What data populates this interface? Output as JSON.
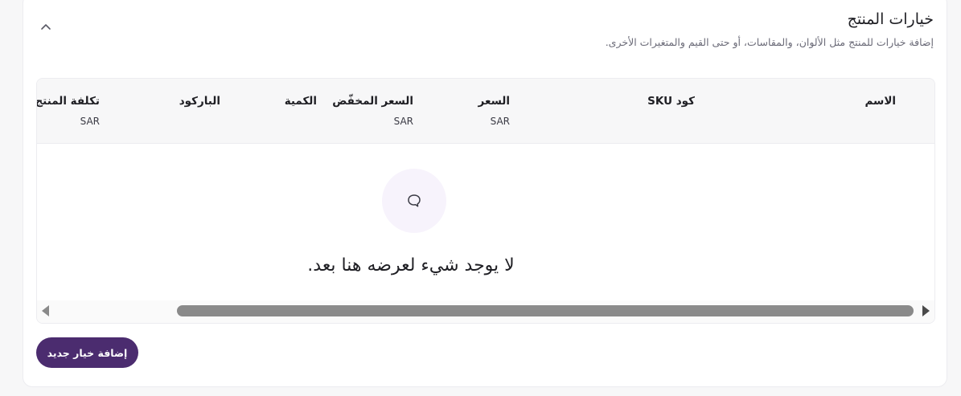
{
  "header": {
    "title": "خيارات المنتج",
    "subtitle": "إضافة خيارات للمنتج مثل الألوان، والمقاسات، أو حتى القيم والمتغيرات الأخرى.",
    "collapse_icon": "chevron-up-icon"
  },
  "table": {
    "columns": [
      {
        "label": "الاسم",
        "unit": ""
      },
      {
        "label": "كود SKU",
        "unit": ""
      },
      {
        "label": "السعر",
        "unit": "SAR"
      },
      {
        "label": "السعر المخفّض",
        "unit": "SAR"
      },
      {
        "label": "الكمية",
        "unit": ""
      },
      {
        "label": "الباركود",
        "unit": ""
      },
      {
        "label": "تكلفة المنتج",
        "unit": "SAR"
      }
    ],
    "empty_icon": "speech-bubble-icon",
    "empty_message": "لا يوجد شيء لعرضه هنا بعد."
  },
  "actions": {
    "add_option_label": "إضافة خيار جديد"
  },
  "colors": {
    "accent": "#4b2c6f",
    "empty_circle": "#f7f3fc",
    "header_bg": "#f7f7f8"
  }
}
